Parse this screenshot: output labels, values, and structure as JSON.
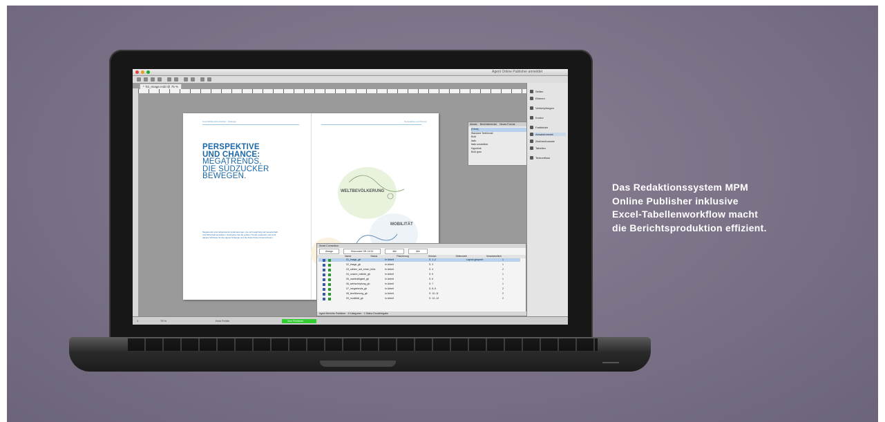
{
  "caption": "Das Redaktionssystem MPM\nOnline Publisher inklusive\nExcel-Tabellenworkflow macht\ndie Berichtsproduktion effizient.",
  "app": {
    "window_title": "Agent Online Publisher anmeldet",
    "document_tab": "* '03_Image.indd @ 75 %",
    "zoom": "75 %"
  },
  "document": {
    "header_left": "Geschäftsbericht 2013/14 · Strategie",
    "header_right": "Perspektive und Chance",
    "headline_bold": [
      "PERSPEKTIVE",
      "UND CHANCE:"
    ],
    "headline_regular": [
      "MEGATRENDS,",
      "DIE SÜDZUCKER",
      "BEWEGEN."
    ],
    "body_text": "Megatrends sind tiefgreifende Veränderungen, die sich langfristig auf Gesellschaft und Wirtschaft auswirken. Südzucker hat die großen Trends analysiert und zieht daraus Schlüsse für die eigene Strategie und die Zukunft des Unternehmens.",
    "illustration_labels": [
      "WELTBEVÖLKERUNG",
      "MOBILITÄT"
    ]
  },
  "panels": {
    "styles_tabs": [
      "Absatz",
      "Berichtsformate",
      "Neues Format"
    ],
    "styles_items": [
      "[Ohne]",
      "Standard Textformat",
      "Bold",
      "Italic",
      "Italic unsichtbar",
      "Hyperlink",
      "Bold grau"
    ],
    "right_panel_items": [
      "Seiten",
      "Ebenen",
      "Verknüpfungen",
      "Kontur",
      "Farbfelder",
      "Absatzformate",
      "Zeichenformate",
      "Tabellen",
      "Textumfluss"
    ]
  },
  "smart_connection": {
    "title": "Smart Connection",
    "filters": [
      "Ablage",
      "Südzucker GB 13/14",
      "Alle",
      "Alle"
    ],
    "columns": [
      "Name",
      "Status",
      "Platzierung",
      "Version",
      "Seitenzahl",
      "Verantwortlich"
    ],
    "rows": [
      [
        "01_image_gb",
        "In Arbeit",
        "S. 1–2",
        "Layout gesperrt",
        "1"
      ],
      [
        "02_image_gb",
        "In Arbeit",
        "S. 3",
        "",
        "1"
      ],
      [
        "03_zahlen_auf_einen_blick",
        "In Arbeit",
        "S. 4",
        "",
        "2"
      ],
      [
        "04_unsere_märkte_gb",
        "In Arbeit",
        "S. 5",
        "",
        "1"
      ],
      [
        "05_nachhaltigkeit_gb",
        "In Arbeit",
        "S. 6",
        "",
        "1"
      ],
      [
        "06_wertschöpfung_gb",
        "In Arbeit",
        "S. 7",
        "",
        "1"
      ],
      [
        "07_megatrends_gb",
        "In Arbeit",
        "S. 8–9",
        "",
        "2"
      ],
      [
        "08_bevölkerung_gb",
        "In Arbeit",
        "S. 10–11",
        "",
        "2"
      ],
      [
        "09_mobilität_gb",
        "In Arbeit",
        "S. 12–13",
        "",
        "2"
      ]
    ],
    "footer": "Agent Berichts Publisher · 3 Kategorien · 1 Status Druckfreigabe"
  },
  "status_bar": {
    "page": "1",
    "info": "Kein Fehler",
    "green_label": "Zum Publishen"
  },
  "colors": {
    "accent_blue": "#1a67a8",
    "status_green": "#33cc33",
    "background": "#7a7186"
  }
}
